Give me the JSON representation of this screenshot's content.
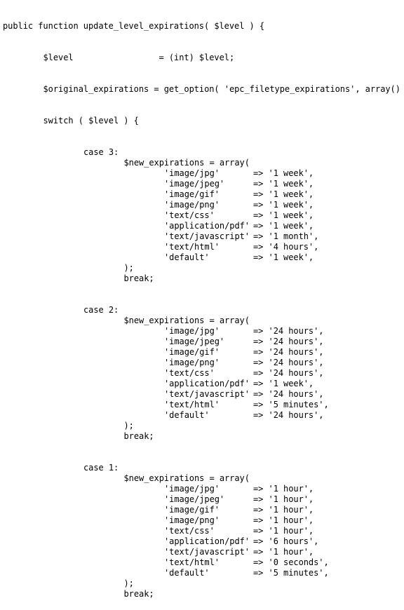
{
  "code": {
    "signature": "public function update_level_expirations( $level ) {",
    "level_assign": "$level                 = (int) $level;",
    "original_assign": "$original_expirations = get_option( 'epc_filetype_expirations', array()",
    "switch_line": "switch ( $level ) {",
    "array_open": "$new_expirations = array(",
    "array_close": ");",
    "break": "break;",
    "cases": [
      {
        "label": "case 3:",
        "entries": [
          {
            "key": "'image/jpg'",
            "value": "=> '1 week',"
          },
          {
            "key": "'image/jpeg'",
            "value": "=> '1 week',"
          },
          {
            "key": "'image/gif'",
            "value": "=> '1 week',"
          },
          {
            "key": "'image/png'",
            "value": "=> '1 week',"
          },
          {
            "key": "'text/css'",
            "value": "=> '1 week',"
          },
          {
            "key": "'application/pdf'",
            "value": "=> '1 week',"
          },
          {
            "key": "'text/javascript'",
            "value": "=> '1 month',"
          },
          {
            "key": "'text/html'",
            "value": "=> '4 hours',"
          },
          {
            "key": "'default'",
            "value": "=> '1 week',"
          }
        ]
      },
      {
        "label": "case 2:",
        "entries": [
          {
            "key": "'image/jpg'",
            "value": "=> '24 hours',"
          },
          {
            "key": "'image/jpeg'",
            "value": "=> '24 hours',"
          },
          {
            "key": "'image/gif'",
            "value": "=> '24 hours',"
          },
          {
            "key": "'image/png'",
            "value": "=> '24 hours',"
          },
          {
            "key": "'text/css'",
            "value": "=> '24 hours',"
          },
          {
            "key": "'application/pdf'",
            "value": "=> '1 week',"
          },
          {
            "key": "'text/javascript'",
            "value": "=> '24 hours',"
          },
          {
            "key": "'text/html'",
            "value": "=> '5 minutes',"
          },
          {
            "key": "'default'",
            "value": "=> '24 hours',"
          }
        ]
      },
      {
        "label": "case 1:",
        "entries": [
          {
            "key": "'image/jpg'",
            "value": "=> '1 hour',"
          },
          {
            "key": "'image/jpeg'",
            "value": "=> '1 hour',"
          },
          {
            "key": "'image/gif'",
            "value": "=> '1 hour',"
          },
          {
            "key": "'image/png'",
            "value": "=> '1 hour',"
          },
          {
            "key": "'text/css'",
            "value": "=> '1 hour',"
          },
          {
            "key": "'application/pdf'",
            "value": "=> '6 hours',"
          },
          {
            "key": "'text/javascript'",
            "value": "=> '1 hour',"
          },
          {
            "key": "'text/html'",
            "value": "=> '0 seconds',"
          },
          {
            "key": "'default'",
            "value": "=> '5 minutes',"
          }
        ]
      }
    ]
  }
}
